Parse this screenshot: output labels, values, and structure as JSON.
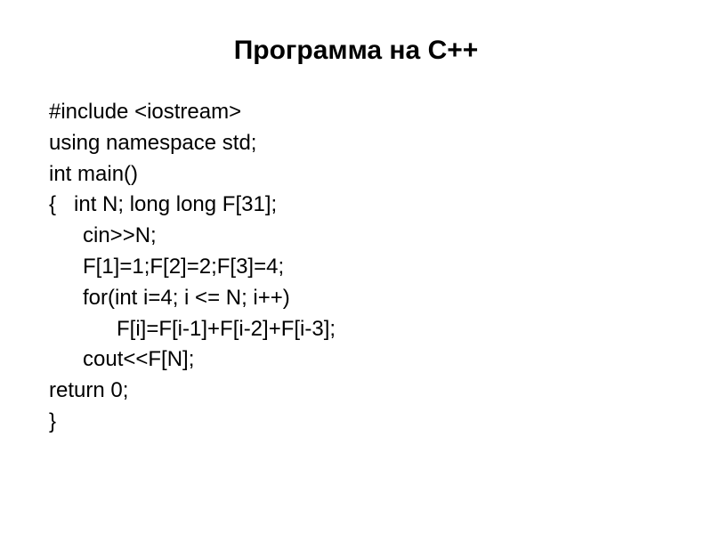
{
  "title": "Программа на C++",
  "code": {
    "line1": "#include <iostream>",
    "line2": "using namespace std;",
    "line3": "int main()",
    "line4": "{   int N; long long F[31];",
    "line5": "cin>>N;",
    "line6": "F[1]=1;F[2]=2;F[3]=4;",
    "line7": "for(int i=4; i <= N; i++)",
    "line8": "F[i]=F[i-1]+F[i-2]+F[i-3];",
    "line9": "cout<<F[N];",
    "line10": "return 0;",
    "line11": "}"
  }
}
